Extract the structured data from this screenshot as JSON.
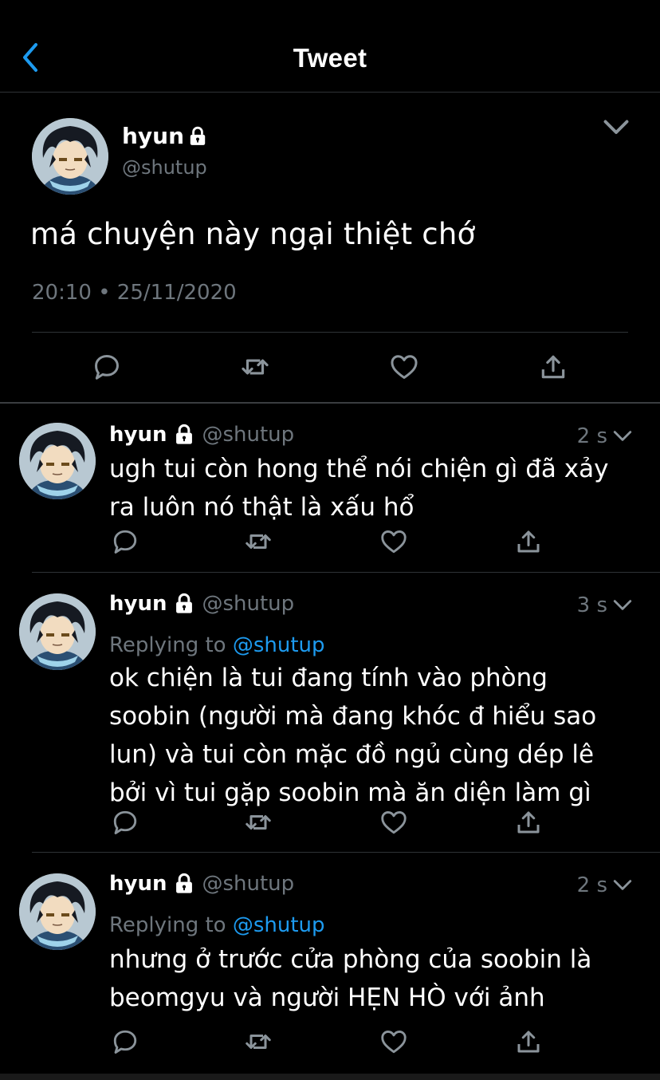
{
  "header": {
    "title": "Tweet"
  },
  "main_tweet": {
    "name": "hyun",
    "handle": "@shutup",
    "text": "má chuyện này ngại thiệt chớ",
    "timestamp": "20:10 • 25/11/2020"
  },
  "replies": [
    {
      "name": "hyun",
      "handle": "@shutup",
      "time": "2 s",
      "replying_label": "",
      "replying_to": "",
      "text": "ugh tui còn hong thể nói chiện gì đã xảy ra luôn nó thật là xấu hổ"
    },
    {
      "name": "hyun",
      "handle": "@shutup",
      "time": "3 s",
      "replying_label": "Replying to ",
      "replying_to": "@shutup",
      "text": "ok chiện là tui đang tính vào phòng soobin (người mà đang khóc đ hiểu sao lun) và tui còn mặc đồ ngủ cùng dép lê bởi vì tui gặp soobin mà ăn diện làm gì"
    },
    {
      "name": "hyun",
      "handle": "@shutup",
      "time": "2 s",
      "replying_label": "Replying to ",
      "replying_to": "@shutup",
      "text": "nhưng ở trước cửa phòng của soobin là beomgyu và người HẸN HÒ với ảnh"
    }
  ],
  "colors": {
    "background": "#000000",
    "muted": "#6e767d",
    "accent": "#1d9bf0"
  }
}
